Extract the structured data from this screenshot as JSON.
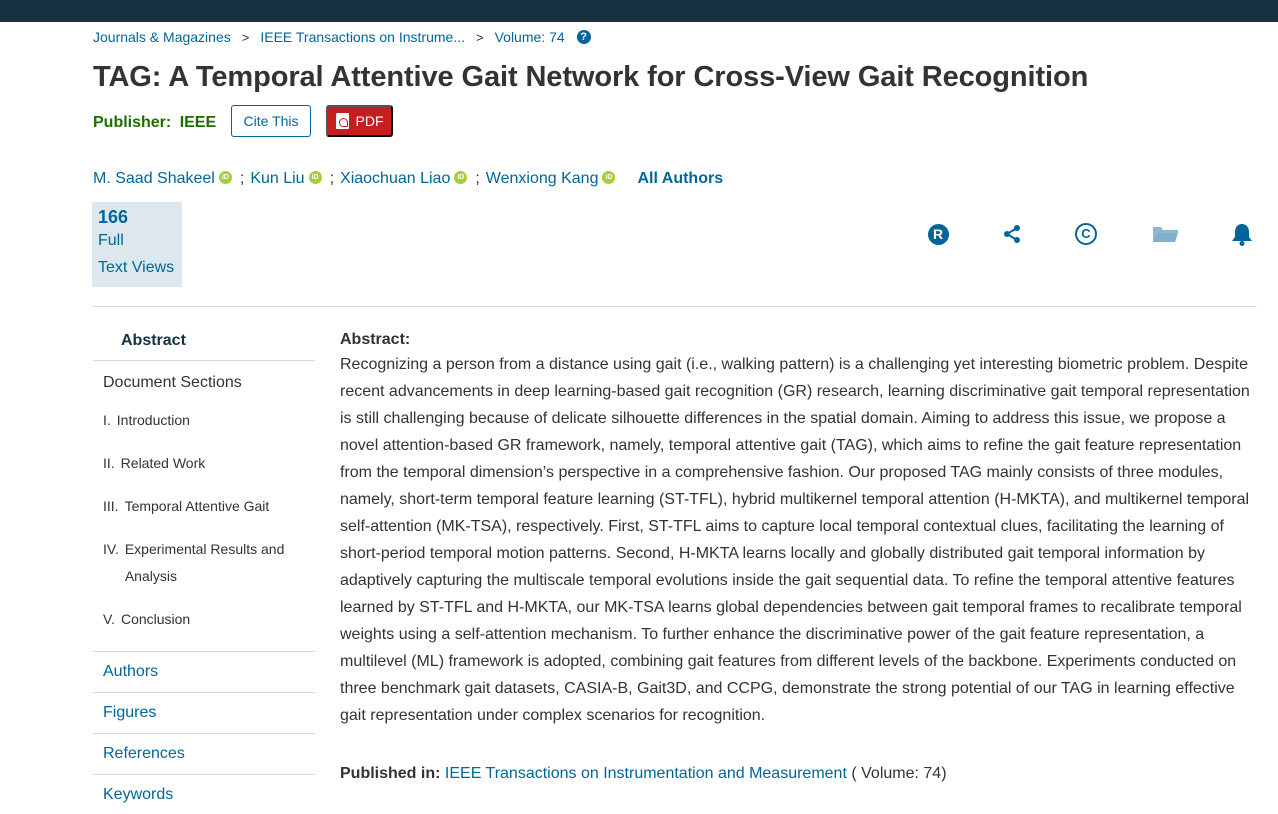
{
  "breadcrumb": {
    "items": [
      "Journals & Magazines",
      "IEEE Transactions on Instrume...",
      "Volume: 74"
    ],
    "separator": ">",
    "help_icon": "question-circle-icon"
  },
  "article": {
    "title": "TAG: A Temporal Attentive Gait Network for Cross-View Gait Recognition",
    "publisher_label": "Publisher:",
    "publisher_name": "IEEE",
    "cite_label": "Cite This",
    "pdf_label": "PDF"
  },
  "authors": {
    "list": [
      "M. Saad Shakeel",
      "Kun Liu",
      "Xiaochuan Liao",
      "Wenxiong Kang"
    ],
    "separator": ";",
    "all_authors_label": "All Authors",
    "orcid_text": "iD"
  },
  "metrics": {
    "count": "166",
    "label_line1": "Full",
    "label_line2": "Text Views"
  },
  "actions": {
    "icons": [
      "rights-permissions-icon",
      "share-icon",
      "copyright-icon",
      "folder-icon",
      "bell-icon"
    ],
    "rights_glyph": "R",
    "copyright_glyph": "C"
  },
  "sidenav": {
    "abstract_label": "Abstract",
    "document_sections_label": "Document Sections",
    "sections": [
      {
        "num": "I.",
        "label": "Introduction"
      },
      {
        "num": "II.",
        "label": "Related Work"
      },
      {
        "num": "III.",
        "label": "Temporal Attentive Gait"
      },
      {
        "num": "IV.",
        "label": "Experimental Results and Analysis"
      },
      {
        "num": "V.",
        "label": "Conclusion"
      }
    ],
    "bottom_links": [
      "Authors",
      "Figures",
      "References",
      "Keywords"
    ]
  },
  "abstract": {
    "heading": "Abstract:",
    "text": "Recognizing a person from a distance using gait (i.e., walking pattern) is a challenging yet interesting biometric problem. Despite recent advancements in deep learning-based gait recognition (GR) research, learning discriminative gait temporal representation is still challenging because of delicate silhouette differences in the spatial domain. Aiming to address this issue, we propose a novel attention-based GR framework, namely, temporal attentive gait (TAG), which aims to refine the gait feature representation from the temporal dimension’s perspective in a comprehensive fashion. Our proposed TAG mainly consists of three modules, namely, short-term temporal feature learning (ST-TFL), hybrid multikernel temporal attention (H-MKTA), and multikernel temporal self-attention (MK-TSA), respectively. First, ST-TFL aims to capture local temporal contextual clues, facilitating the learning of short-period temporal motion patterns. Second, H-MKTA learns locally and globally distributed gait temporal information by adaptively capturing the multiscale temporal evolutions inside the gait sequential data. To refine the temporal attentive features learned by ST-TFL and H-MKTA, our MK-TSA learns global dependencies between gait temporal frames to recalibrate temporal weights using a self-attention mechanism. To further enhance the discriminative power of the gait feature representation, a multilevel (ML) framework is adopted, combining gait features from different levels of the backbone. Experiments conducted on three benchmark gait datasets, CASIA-B, Gait3D, and CCPG, demonstrate the strong potential of our TAG in learning effective gait representation under complex scenarios for recognition."
  },
  "published": {
    "label": "Published in:",
    "journal": "IEEE Transactions on Instrumentation and Measurement",
    "volume": "( Volume: 74)"
  },
  "colors": {
    "link": "#006699",
    "topbar": "#16313f",
    "publisher_green": "#1d6e00",
    "pdf_red": "#c41e1e",
    "orcid_green": "#a6ce39",
    "metrics_bg": "#dde7ee"
  }
}
